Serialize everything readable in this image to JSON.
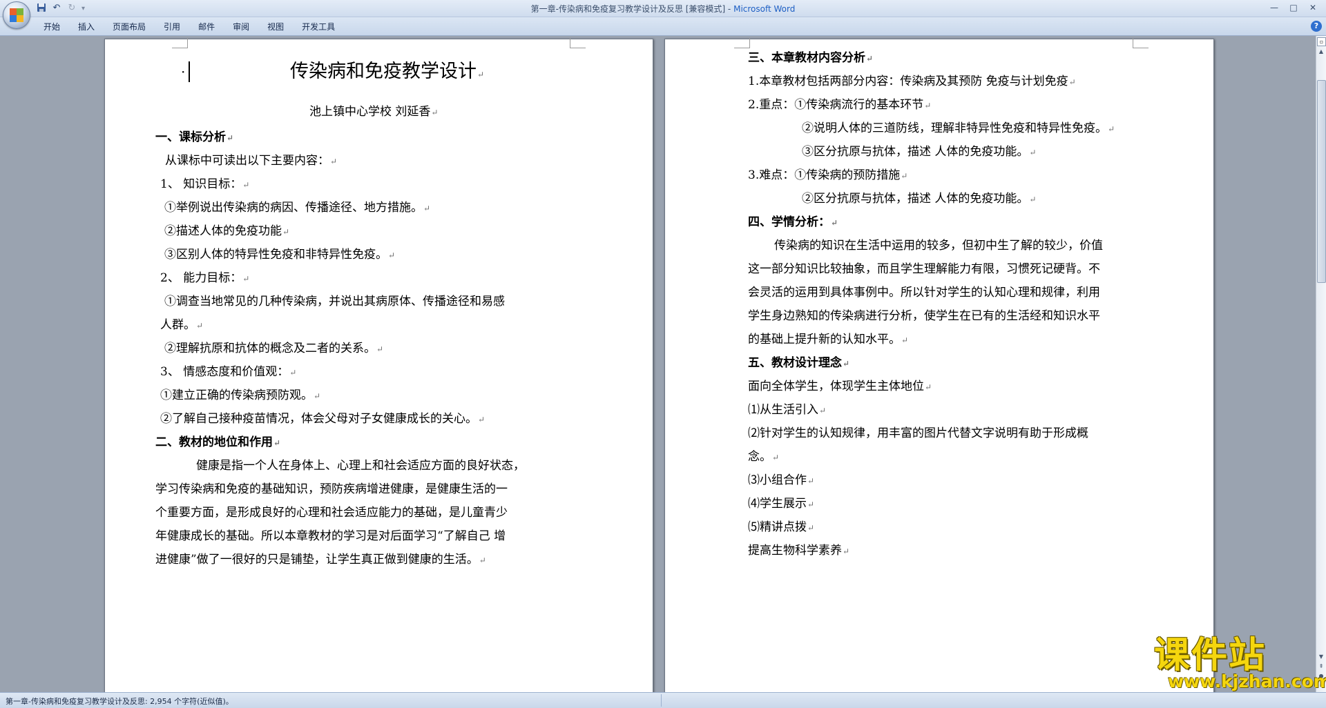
{
  "window": {
    "title": "第一章-传染病和免疫复习教学设计及反思 [兼容模式] - ",
    "app_name": "Microsoft Word"
  },
  "ribbon": {
    "tabs": [
      "开始",
      "插入",
      "页面布局",
      "引用",
      "邮件",
      "审阅",
      "视图",
      "开发工具"
    ]
  },
  "document": {
    "page1": {
      "title": "传染病和免疫教学设计",
      "author": "池上镇中心学校   刘延香",
      "lines": [
        "一、课标分析",
        "从课标中可读出以下主要内容：",
        "1、    知识目标：",
        "①举例说出传染病的病因、传播途径、地方措施。",
        "②描述人体的免疫功能",
        "③区别人体的特异性免疫和非特异性免疫。",
        "2、    能力目标：",
        "①调查当地常见的几种传染病，并说出其病原体、传播途径和易感",
        "人群。",
        "②理解抗原和抗体的概念及二者的关系。",
        "3、    情感态度和价值观：",
        "①建立正确的传染病预防观。",
        "②了解自己接种疫苗情况，体会父母对子女健康成长的关心。",
        "二、教材的地位和作用",
        "健康是指一个人在身体上、心理上和社会适应方面的良好状态，",
        "学习传染病和免疫的基础知识，预防疾病增进健康，是健康生活的一",
        "个重要方面，是形成良好的心理和社会适应能力的基础，是儿童青少",
        "年健康成长的基础。所以本章教材的学习是对后面学习“了解自己  增",
        "进健康”做了一很好的只是铺垫，让学生真正做到健康的生活。"
      ]
    },
    "page2": {
      "lines": [
        "三、本章教材内容分析",
        "1.本章教材包括两部分内容：传染病及其预防      免疫与计划免疫",
        "2.重点：①传染病流行的基本环节",
        "②说明人体的三道防线，理解非特异性免疫和特异性免疫。",
        "③区分抗原与抗体，描述 人体的免疫功能。",
        "3.难点：①传染病的预防措施",
        "②区分抗原与抗体，描述 人体的免疫功能。",
        "四、学情分析：",
        "传染病的知识在生活中运用的较多，但初中生了解的较少，价值",
        "这一部分知识比较抽象，而且学生理解能力有限，习惯死记硬背。不",
        "会灵活的运用到具体事例中。所以针对学生的认知心理和规律，利用",
        "学生身边熟知的传染病进行分析，使学生在已有的生活经和知识水平",
        "的基础上提升新的认知水平。",
        "五、教材设计理念",
        "面向全体学生，体现学生主体地位",
        "⑴从生活引入",
        "⑵针对学生的认知规律，用丰富的图片代替文字说明有助于形成概",
        "念。",
        "⑶小组合作",
        "⑷学生展示",
        "⑸精讲点拨",
        "提高生物科学素养"
      ]
    },
    "paragraph_mark": "↵"
  },
  "statusbar": {
    "text": "第一章-传染病和免疫复习教学设计及反思: 2,954 个字符(近似值)。"
  },
  "watermark": {
    "main": "课件站",
    "url": "www.kjzhan.com"
  },
  "colors": {
    "accent": "#1d5fc4",
    "page": "#ffffff",
    "background": "#9aa3b0",
    "watermark": "#f5d60e"
  },
  "icons": [
    "office-button-icon",
    "save-icon",
    "undo-icon",
    "redo-icon",
    "customize-qat-icon",
    "minimize-icon",
    "maximize-icon",
    "close-icon",
    "help-icon",
    "scroll-up-icon",
    "scroll-down-icon",
    "prev-page-icon",
    "next-page-icon",
    "select-browse-object-icon"
  ]
}
